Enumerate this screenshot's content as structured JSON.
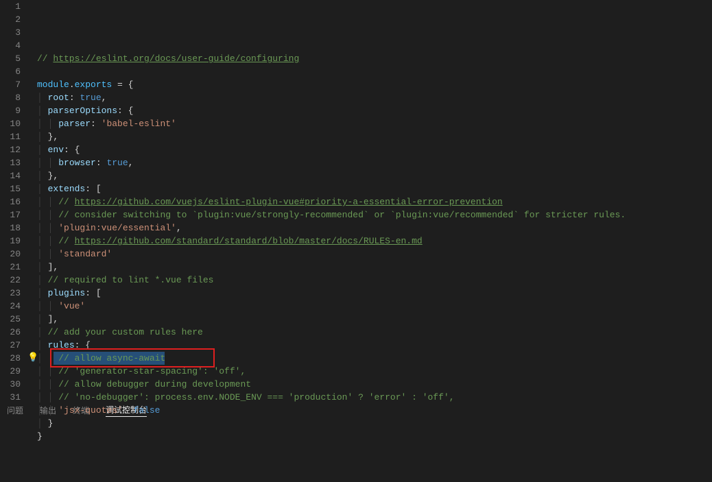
{
  "lineNumbers": [
    "1",
    "2",
    "3",
    "4",
    "5",
    "6",
    "7",
    "8",
    "9",
    "10",
    "11",
    "12",
    "13",
    "14",
    "15",
    "16",
    "17",
    "18",
    "19",
    "20",
    "21",
    "22",
    "23",
    "24",
    "25",
    "26",
    "27",
    "28",
    "29",
    "30",
    "31"
  ],
  "code": {
    "l1_comment_prefix": "// ",
    "l1_link": "https://eslint.org/docs/user-guide/configuring",
    "l3_module": "module",
    "l3_dot": ".",
    "l3_exports": "exports",
    "l3_rest": " = {",
    "l4_key": "root",
    "l4_val": "true",
    "l5_key": "parserOptions",
    "l5_rest": ": {",
    "l6_key": "parser",
    "l6_val": "'babel-eslint'",
    "l7": "},",
    "l8_key": "env",
    "l8_rest": ": {",
    "l9_key": "browser",
    "l9_val": "true",
    "l10": "},",
    "l11_key": "extends",
    "l11_rest": ": [",
    "l12_comment_prefix": "// ",
    "l12_link": "https://github.com/vuejs/eslint-plugin-vue#priority-a-essential-error-prevention",
    "l13_comment": "// consider switching to `plugin:vue/strongly-recommended` or `plugin:vue/recommended` for stricter rules.",
    "l14_val": "'plugin:vue/essential'",
    "l15_comment_prefix": "// ",
    "l15_link": "https://github.com/standard/standard/blob/master/docs/RULES-en.md",
    "l16_val": "'standard'",
    "l17": "],",
    "l18_comment": "// required to lint *.vue files",
    "l19_key": "plugins",
    "l19_rest": ": [",
    "l20_val": "'vue'",
    "l21": "],",
    "l22_comment": "// add your custom rules here",
    "l23_key": "rules",
    "l23_rest": ": {",
    "l24_comment": "// allow async-await",
    "l25_comment": "// 'generator-star-spacing': 'off',",
    "l26_comment": "// allow debugger during development",
    "l27_comment": "// 'no-debugger': process.env.NODE_ENV === 'production' ? 'error' : 'off',",
    "l28_key": "'jsx-quotes'",
    "l28_colon": ": ",
    "l28_val": "false",
    "l29": "}",
    "l30": "}"
  },
  "panel": {
    "tabs": [
      "问题",
      "输出",
      "终端",
      "调试控制台"
    ],
    "activeIndex": 3
  },
  "highlight": {
    "line": 28,
    "selected_text": "'jsx-quotes': false"
  }
}
